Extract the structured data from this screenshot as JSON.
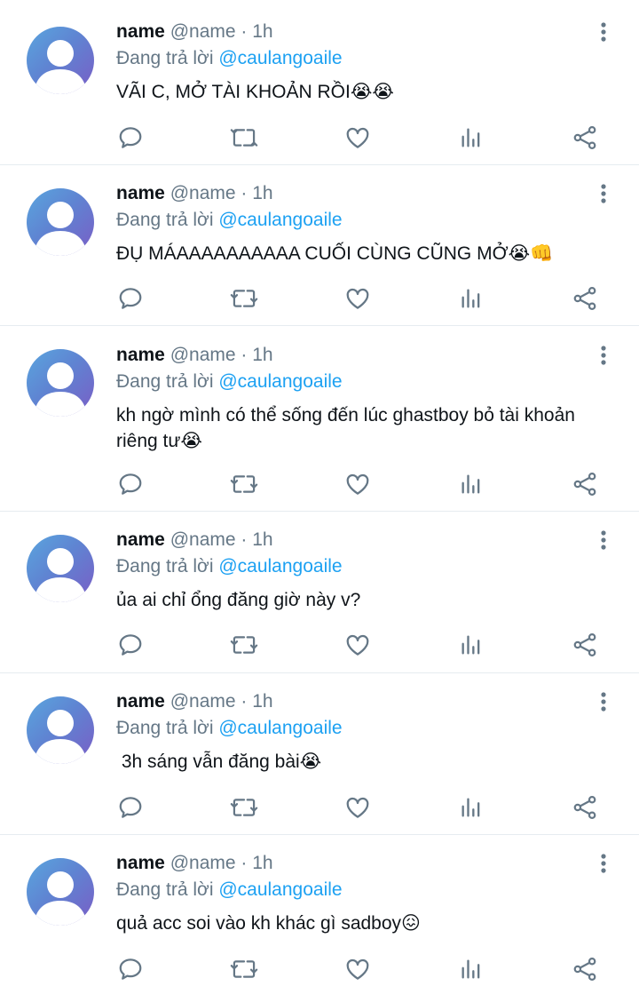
{
  "tweets": [
    {
      "name": "name",
      "handle": "@name",
      "sep": " · ",
      "time": "1h",
      "reply_prefix": "Đang trả lời ",
      "reply_to": "@caulangoaile",
      "text": "VÃI C, MỞ TÀI KHOẢN RỒI😭😭"
    },
    {
      "name": "name",
      "handle": "@name",
      "sep": " · ",
      "time": "1h",
      "reply_prefix": "Đang trả lời ",
      "reply_to": "@caulangoaile",
      "text": "ĐỤ MÁAAAAAAAAAA CUỐI CÙNG CŨNG MỞ😭👊"
    },
    {
      "name": "name",
      "handle": "@name",
      "sep": " · ",
      "time": "1h",
      "reply_prefix": "Đang trả lời ",
      "reply_to": "@caulangoaile",
      "text": "kh ngờ mình có thể sống đến lúc ghastboy bỏ tài khoản riêng tư😭"
    },
    {
      "name": "name",
      "handle": "@name",
      "sep": " · ",
      "time": "1h",
      "reply_prefix": "Đang trả lời ",
      "reply_to": "@caulangoaile",
      "text": "ủa ai chỉ ổng đăng giờ này v?"
    },
    {
      "name": "name",
      "handle": "@name",
      "sep": " · ",
      "time": "1h",
      "reply_prefix": "Đang trả lời ",
      "reply_to": "@caulangoaile",
      "text": " 3h sáng vẫn đăng bài😭"
    },
    {
      "name": "name",
      "handle": "@name",
      "sep": " · ",
      "time": "1h",
      "reply_prefix": "Đang trả lời ",
      "reply_to": "@caulangoaile",
      "text": "quả acc soi vào kh khác gì sadboy😖"
    }
  ],
  "icons": {
    "reply": "reply-icon",
    "retweet": "retweet-icon",
    "like": "like-icon",
    "analytics": "analytics-icon",
    "share": "share-icon",
    "more": "more-vertical-icon"
  },
  "colors": {
    "icon": "#657786",
    "mention": "#1da1f2",
    "divider": "#e6ecf0"
  }
}
